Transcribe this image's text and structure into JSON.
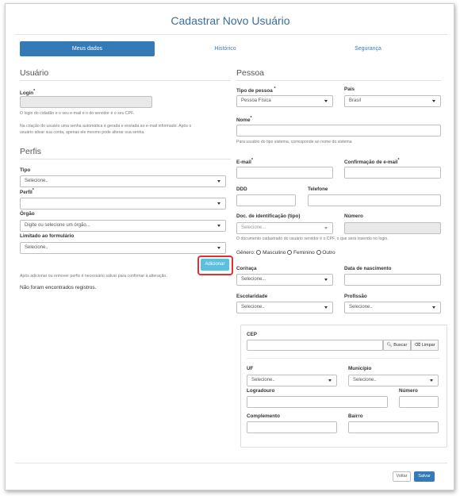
{
  "header": {
    "title": "Cadastrar Novo Usuário"
  },
  "tabs": [
    "Meus dados",
    "Histórico",
    "Segurança"
  ],
  "usuario": {
    "section_title": "Usuário",
    "login_label": "Login",
    "login_value": "",
    "help_1": "O login do cidadão e o seu e-mail e o do servidor é o seu CPF.",
    "help_2a": "Na criação do usuário uma senha automática é gerada e enviada ao e-mail informado. Após o",
    "help_2b": "usuário ativar sua conta, apenas ele mesmo pode alterar sua senha."
  },
  "perfis": {
    "section_title": "Perfis",
    "tipo_label": "Tipo",
    "tipo_value": "Selecione..",
    "perfil_label": "Perfil",
    "perfil_value": "",
    "orgao_label": "Órgão",
    "orgao_placeholder": "Digite ou  selecione um órgão...",
    "limitado_label": "Limitado ao formulário",
    "limitado_value": "Selecione..",
    "add_button": "Adicionar",
    "save_hint": "Após adicionar ou remover perfis é necessário salvar para confirmar a alteração.",
    "empty_text": "Não foram encontrados registros."
  },
  "pessoa": {
    "section_title": "Pessoa",
    "tipo_label": "Tipo de pessoa",
    "tipo_value": "Pessoa Física",
    "pais_label": "País",
    "pais_value": "Brasil",
    "nome_label": "Nome",
    "nome_value": "",
    "nome_help": "Para usuário do tipo sistema, corresponde ao nome do sistema",
    "email_label": "E-mail",
    "confirm_email_label": "Confirmação de e-mail",
    "ddd_label": "DDD",
    "telefone_label": "Telefone",
    "doc_tipo_label": "Doc. de identificação (tipo)",
    "doc_tipo_value": "Selecione...",
    "numero_label": "Número",
    "doc_help": "O documento cadastrado do usuário servidor é o CPF, o que será inserido no login.",
    "genero_label": "Gênero:",
    "genero_options": [
      "Masculino",
      "Feminino",
      "Outro"
    ],
    "cor_label": "Cor/raça",
    "cor_value": "Selecione...",
    "nascimento_label": "Data de nascimento",
    "escolaridade_label": "Escolaridade",
    "escolaridade_value": "Selecione..",
    "profissao_label": "Profissão",
    "profissao_value": "Selecione.."
  },
  "endereco": {
    "cep_label": "CEP",
    "buscar_button": "Buscar",
    "limpar_button": "Limpar",
    "uf_label": "UF",
    "uf_value": "Selecione..",
    "municipio_label": "Município",
    "municipio_value": "Selecione..",
    "logradouro_label": "Logradouro",
    "numero_label": "Número",
    "complemento_label": "Complemento",
    "bairro_label": "Bairro"
  },
  "footer": {
    "voltar_button": "Voltar",
    "salvar_button": "Salvar"
  },
  "colors": {
    "primary": "#337ab7",
    "info": "#5bc0de",
    "highlight": "#e0312e",
    "title": "#3a6d9a"
  }
}
